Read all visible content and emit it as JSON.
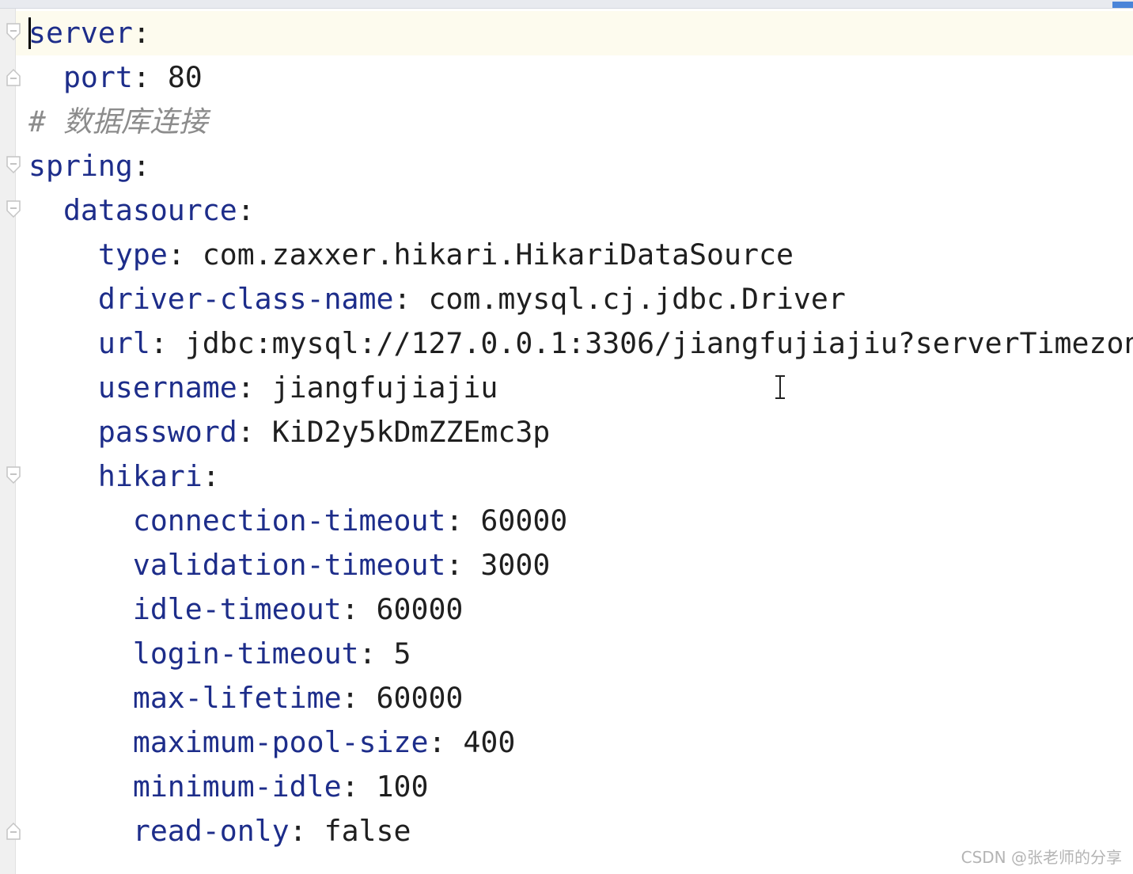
{
  "editor": {
    "lines": [
      {
        "key": "server",
        "colon": ":",
        "value": ""
      },
      {
        "key": "port",
        "colon": ":",
        "value": "80"
      },
      {
        "comment": "# 数据库连接"
      },
      {
        "key": "spring",
        "colon": ":",
        "value": ""
      },
      {
        "key": "datasource",
        "colon": ":",
        "value": ""
      },
      {
        "key": "type",
        "colon": ":",
        "value": "com.zaxxer.hikari.HikariDataSource"
      },
      {
        "key": "driver-class-name",
        "colon": ":",
        "value": "com.mysql.cj.jdbc.Driver"
      },
      {
        "key": "url",
        "colon": ":",
        "value": "jdbc:mysql://127.0.0.1:3306/jiangfujiajiu?serverTimezon"
      },
      {
        "key": "username",
        "colon": ":",
        "value": "jiangfujiajiu"
      },
      {
        "key": "password",
        "colon": ":",
        "value": "KiD2y5kDmZZEmc3p"
      },
      {
        "key": "hikari",
        "colon": ":",
        "value": ""
      },
      {
        "key": "connection-timeout",
        "colon": ":",
        "value": "60000"
      },
      {
        "key": "validation-timeout",
        "colon": ":",
        "value": "3000"
      },
      {
        "key": "idle-timeout",
        "colon": ":",
        "value": "60000"
      },
      {
        "key": "login-timeout",
        "colon": ":",
        "value": "5"
      },
      {
        "key": "max-lifetime",
        "colon": ":",
        "value": "60000"
      },
      {
        "key": "maximum-pool-size",
        "colon": ":",
        "value": "400"
      },
      {
        "key": "minimum-idle",
        "colon": ":",
        "value": "100"
      },
      {
        "key": "read-only",
        "colon": ":",
        "value": "false"
      }
    ],
    "server_key_first_char": "s",
    "server_key_rest": "erver"
  },
  "watermark": "CSDN @张老师的分享",
  "colors": {
    "key": "#1d2d8a",
    "comment": "#8c8c8c",
    "current_line": "#fdfbee"
  },
  "icons": {
    "fold": "fold-marker-icon",
    "cursor": "text-cursor-icon"
  }
}
